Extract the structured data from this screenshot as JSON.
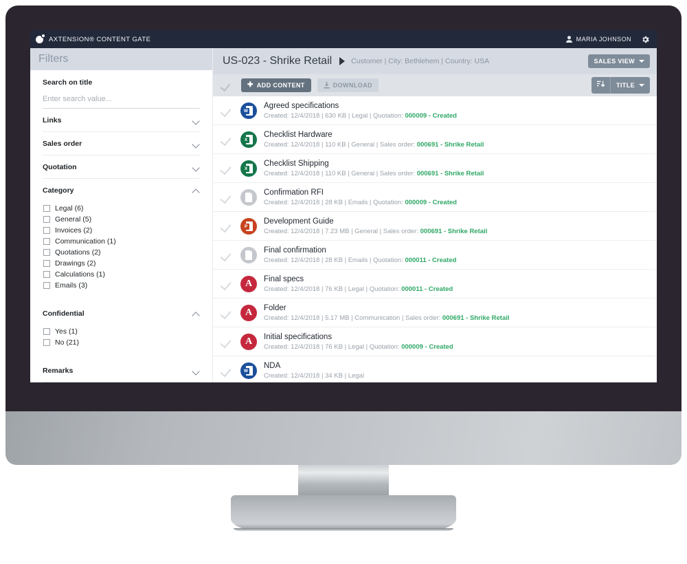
{
  "app": {
    "brand": "AXTENSION® CONTENT GATE",
    "logo_icon": "gate-logo-icon",
    "user": "MARIA JOHNSON",
    "user_icon": "person-icon",
    "settings_icon": "gear-icon"
  },
  "sidebar": {
    "header": "Filters",
    "search": {
      "label": "Search on title",
      "value": "",
      "placeholder": "Enter search value..."
    },
    "sections": [
      {
        "title": "Links",
        "state": "collapsed"
      },
      {
        "title": "Sales order",
        "state": "collapsed"
      },
      {
        "title": "Quotation",
        "state": "collapsed"
      },
      {
        "title": "Category",
        "state": "expanded",
        "options": [
          {
            "label": "Legal (6)",
            "checked": false
          },
          {
            "label": "General (5)",
            "checked": false
          },
          {
            "label": "Invoices (2)",
            "checked": false
          },
          {
            "label": "Communication (1)",
            "checked": false
          },
          {
            "label": "Quotations (2)",
            "checked": false
          },
          {
            "label": "Drawings (2)",
            "checked": false
          },
          {
            "label": "Calculations (1)",
            "checked": false
          },
          {
            "label": "Emails (3)",
            "checked": false
          }
        ]
      },
      {
        "title": "Confidential",
        "state": "expanded",
        "options": [
          {
            "label": "Yes (1)",
            "checked": false
          },
          {
            "label": "No (21)",
            "checked": false
          }
        ]
      },
      {
        "title": "Remarks",
        "state": "collapsed"
      }
    ]
  },
  "header": {
    "title": "US-023 - Shrike Retail",
    "subtitle": "Customer | City: Bethlehem | Country: USA",
    "view_button": "SALES VIEW"
  },
  "toolbar": {
    "select_all_icon": "check-icon",
    "add_content": "ADD CONTENT",
    "add_content_icon": "plus-icon",
    "download": "DOWNLOAD",
    "download_icon": "download-icon",
    "sort_icon": "sort-icon",
    "sort_by": "TITLE"
  },
  "documents": [
    {
      "name": "Agreed specifications",
      "icon": "word",
      "meta_prefix": "Created: 12/4/2018 | 630 KB | Legal | Quotation: ",
      "link": "000009 - Created"
    },
    {
      "name": "Checklist Hardware",
      "icon": "excel",
      "meta_prefix": "Created: 12/4/2018 | 110 KB | General | Sales order: ",
      "link": "000691 - Shrike Retail"
    },
    {
      "name": "Checklist Shipping",
      "icon": "excel",
      "meta_prefix": "Created: 12/4/2018 | 110 KB | General | Sales order: ",
      "link": "000691 - Shrike Retail"
    },
    {
      "name": "Confirmation RFI",
      "icon": "generic",
      "meta_prefix": "Created: 12/4/2018 | 28 KB | Emails | Quotation: ",
      "link": "000009 - Created"
    },
    {
      "name": "Development Guide",
      "icon": "ppt",
      "meta_prefix": "Created: 12/4/2018 | 7.23 MB | General | Sales order: ",
      "link": "000691 - Shrike Retail"
    },
    {
      "name": "Final confirmation",
      "icon": "generic",
      "meta_prefix": "Created: 12/4/2018 | 28 KB | Emails | Quotation: ",
      "link": "000011 - Created"
    },
    {
      "name": "Final specs",
      "icon": "pdf",
      "meta_prefix": "Created: 12/4/2018 | 76 KB | Legal | Quotation: ",
      "link": "000011 - Created"
    },
    {
      "name": "Folder",
      "icon": "pdf",
      "meta_prefix": "Created: 12/4/2018 | 5.17 MB | Communication | Sales order: ",
      "link": "000691 - Shrike Retail"
    },
    {
      "name": "Initial specifications",
      "icon": "pdf",
      "meta_prefix": "Created: 12/4/2018 | 76 KB | Legal | Quotation: ",
      "link": "000009 - Created"
    },
    {
      "name": "NDA",
      "icon": "word",
      "meta_prefix": "Created: 12/4/2018 | 34 KB | Legal",
      "link": ""
    }
  ],
  "colors": {
    "topbar": "#22293a",
    "panel_header": "#d6dbe3",
    "accent_button": "#7e8b99",
    "dark_button": "#64727f",
    "link_green": "#2fa866",
    "bezel": "#2a252e"
  }
}
